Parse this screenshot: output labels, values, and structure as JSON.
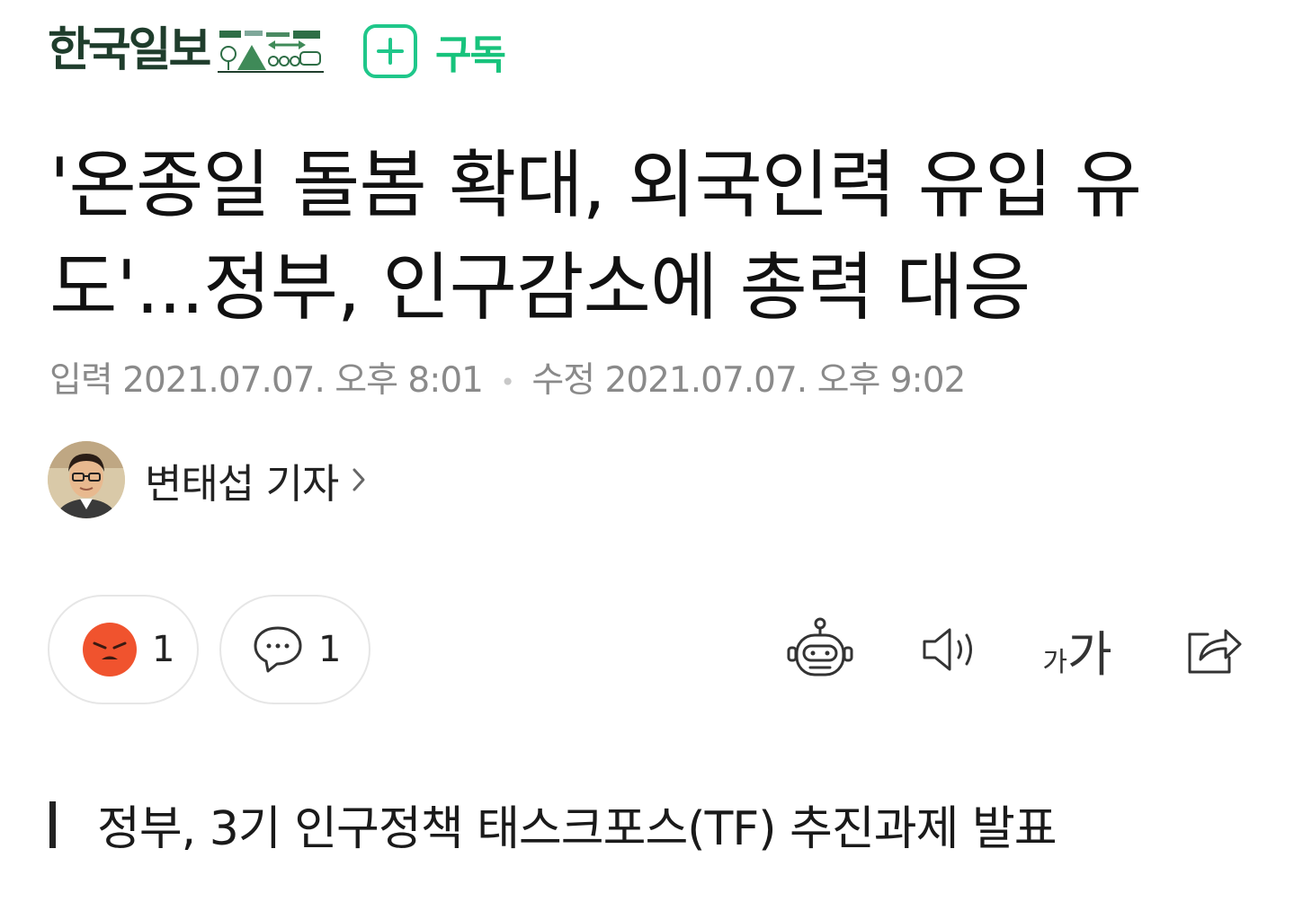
{
  "header": {
    "publisher": "한국일보",
    "subscribe_label": "구독"
  },
  "article": {
    "title": "'온종일 돌봄 확대, 외국인력 유입 유도'...정부, 인구감소에 총력 대응",
    "input_label": "입력",
    "input_datetime": "2021.07.07. 오후 8:01",
    "separator": "•",
    "modified_label": "수정",
    "modified_datetime": "2021.07.07. 오후 9:02",
    "author": "변태섭 기자",
    "subheading": "정부, 3기 인구정책 태스크포스(TF) 추진과제 발표"
  },
  "actions": {
    "reaction_count": "1",
    "comment_count": "1",
    "font_small": "가",
    "font_big": "가"
  },
  "colors": {
    "accent": "#17c37c",
    "brand_dark": "#1f3d2c",
    "reaction": "#f0532e",
    "meta_text": "#8a8a8a"
  },
  "icons": {
    "subscribe": "plus-icon",
    "author_link": "chevron-right-icon",
    "reaction": "angry-face-icon",
    "comment": "speech-bubble-icon",
    "summary": "robot-icon",
    "listen": "speaker-icon",
    "font_size": "font-size-icon",
    "share": "share-icon"
  }
}
